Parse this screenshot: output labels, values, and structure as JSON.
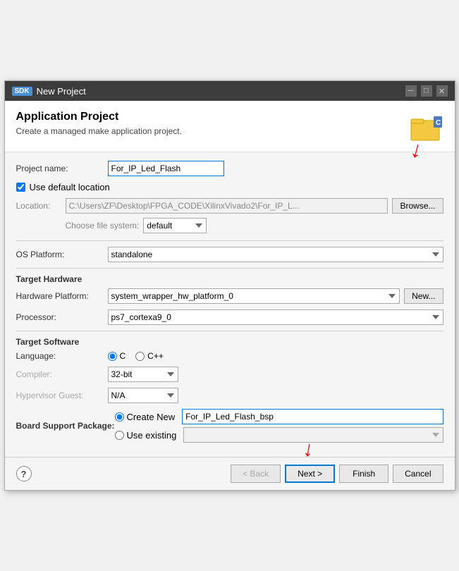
{
  "titleBar": {
    "badge": "SDK",
    "title": "New Project",
    "minimize": "─",
    "maximize": "□",
    "close": "✕"
  },
  "header": {
    "title": "Application Project",
    "subtitle": "Create a managed make application project."
  },
  "form": {
    "projectNameLabel": "Project name:",
    "projectNameValue": "For_IP_Led_Flash",
    "useDefaultLocationLabel": "Use default location",
    "locationLabel": "Location:",
    "locationValue": "C:\\Users\\ZF\\Desktop\\FPGA_CODE\\XilinxVivado2\\For_IP_L...",
    "browseLabel": "Browse...",
    "chooseFileSystemLabel": "Choose file system:",
    "fileSystemValue": "default",
    "osPlatformLabel": "OS Platform:",
    "osPlatformValue": "standalone",
    "targetHardwareTitle": "Target Hardware",
    "hardwarePlatformLabel": "Hardware Platform:",
    "hardwarePlatformValue": "system_wrapper_hw_platform_0",
    "newLabel": "New...",
    "processorLabel": "Processor:",
    "processorValue": "ps7_cortexa9_0",
    "targetSoftwareTitle": "Target Software",
    "languageLabel": "Language:",
    "languageCLabel": "C",
    "languageCppLabel": "C++",
    "compilerLabel": "Compiler:",
    "compilerValue": "32-bit",
    "hypervisorLabel": "Hypervisor Guest:",
    "hypervisorValue": "N/A",
    "bspLabel": "Board Support Package:",
    "createNewLabel": "Create New",
    "bspNameValue": "For_IP_Led_Flash_bsp",
    "useExistingLabel": "Use existing"
  },
  "footer": {
    "helpSymbol": "?",
    "backLabel": "< Back",
    "nextLabel": "Next >",
    "finishLabel": "Finish",
    "cancelLabel": "Cancel"
  }
}
